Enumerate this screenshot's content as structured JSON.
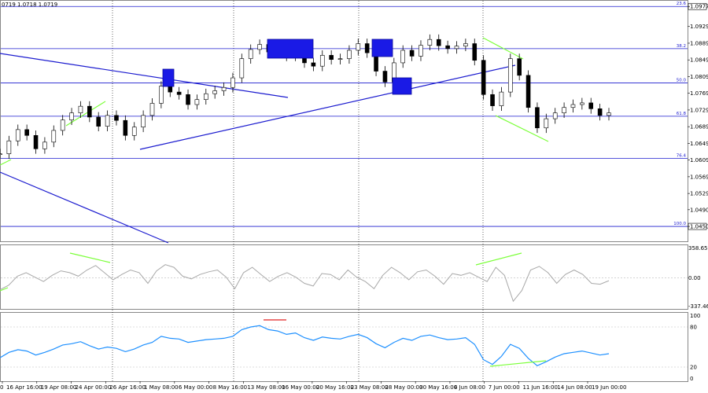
{
  "header": {
    "ohlc_text": "0719 1.0718 1.0719"
  },
  "chart_data": [
    {
      "type": "line",
      "panel": "price",
      "ylim": [
        1.042,
        1.0985
      ],
      "y_ticks": [
        "1.0977",
        "1.0929",
        "1.0889",
        "1.0849",
        "1.0809",
        "1.0769",
        "1.0729",
        "1.0689",
        "1.0649",
        "1.0609",
        "1.0569",
        "1.0529",
        "1.0490",
        "1.0450"
      ],
      "highlighted_prices": [
        "1.0977",
        "1.0876",
        "1.0794",
        "1.0714",
        "1.0613",
        "1.0450"
      ],
      "fib_levels": [
        {
          "label": "23.6",
          "price": 1.0977
        },
        {
          "label": "38.2",
          "price": 1.0876
        },
        {
          "label": "50.0",
          "price": 1.0794
        },
        {
          "label": "61.8",
          "price": 1.0714
        },
        {
          "label": "76.4",
          "price": 1.0613
        },
        {
          "label": "100.0",
          "price": 1.045
        }
      ],
      "x_labels": [
        "16 Apr 16:00",
        "19 Apr 08:00",
        "24 Apr 00:00",
        "26 Apr 16:00",
        "1 May 08:00",
        "6 May 00:00",
        "8 May 16:00",
        "13 May 08:00",
        "16 May 00:00",
        "20 May 16:00",
        "23 May 08:00",
        "28 May 00:00",
        "30 May 16:00",
        "4 Jun 08:00",
        "7 Jun 00:00",
        "11 Jun 16:00",
        "14 Jun 08:00",
        "19 Jun 00:00"
      ],
      "x_labels_partial": [
        "0"
      ],
      "close_series": [
        1.0624,
        1.0655,
        1.0682,
        1.0668,
        1.0636,
        1.0652,
        1.068,
        1.0705,
        1.0722,
        1.0738,
        1.0712,
        1.069,
        1.0716,
        1.0704,
        1.0668,
        1.0688,
        1.0716,
        1.0745,
        1.0786,
        1.0772,
        1.0766,
        1.0742,
        1.0754,
        1.0768,
        1.0775,
        1.0783,
        1.0806,
        1.0852,
        1.0874,
        1.0886,
        1.0868,
        1.0872,
        1.0858,
        1.0868,
        1.0842,
        1.0834,
        1.086,
        1.085,
        1.0852,
        1.0872,
        1.0888,
        1.0866,
        1.0822,
        1.0796,
        1.0842,
        1.0872,
        1.0858,
        1.0884,
        1.0898,
        1.0883,
        1.0876,
        1.0882,
        1.0888,
        1.0848,
        1.0766,
        1.0739,
        1.0772,
        1.0852,
        1.0812,
        1.0735,
        1.0686,
        1.0708,
        1.0722,
        1.0735,
        1.0742,
        1.0746,
        1.0732,
        1.0716,
        1.0722
      ]
    },
    {
      "type": "line",
      "panel": "cci",
      "ylim": [
        -337.462,
        358.6587
      ],
      "y_ticks": [
        "358.6587",
        "0.00",
        "-337.462"
      ],
      "values": [
        -130,
        -80,
        20,
        60,
        10,
        -40,
        30,
        80,
        60,
        20,
        90,
        140,
        60,
        -20,
        40,
        90,
        60,
        -60,
        80,
        150,
        120,
        20,
        -10,
        40,
        70,
        90,
        10,
        -120,
        60,
        120,
        40,
        -40,
        20,
        60,
        10,
        -60,
        -90,
        50,
        40,
        -20,
        90,
        10,
        -40,
        -120,
        30,
        120,
        60,
        -20,
        70,
        90,
        20,
        -70,
        50,
        30,
        60,
        10,
        -40,
        120,
        30,
        -260,
        -140,
        90,
        130,
        60,
        -60,
        40,
        90,
        40,
        -60,
        -70,
        -30
      ]
    },
    {
      "type": "line",
      "panel": "rsi",
      "ylim": [
        0,
        100
      ],
      "y_ticks": [
        "100",
        "80",
        "20",
        "0"
      ],
      "values": [
        34,
        42,
        46,
        44,
        38,
        42,
        47,
        53,
        55,
        58,
        52,
        47,
        50,
        48,
        43,
        47,
        53,
        57,
        66,
        63,
        62,
        57,
        59,
        61,
        62,
        63,
        66,
        76,
        80,
        82,
        76,
        74,
        69,
        71,
        64,
        60,
        65,
        63,
        62,
        66,
        69,
        64,
        55,
        49,
        57,
        63,
        60,
        66,
        68,
        64,
        61,
        62,
        64,
        54,
        31,
        24,
        36,
        54,
        48,
        33,
        22,
        28,
        35,
        40,
        42,
        44,
        41,
        38,
        40
      ]
    }
  ]
}
